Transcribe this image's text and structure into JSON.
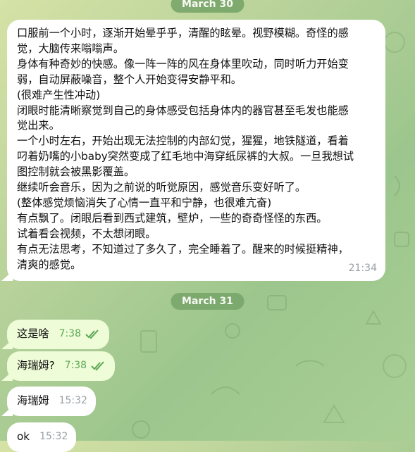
{
  "conversation": {
    "date_1": "March 30",
    "date_2": "March 31",
    "long_message": {
      "lines": [
        "口服前一个小时，逐渐开始晕乎乎，清醒的眩晕。视野模糊。奇怪的感",
        "觉，大脑传来嗡嗡声。",
        "身体有种奇妙的快感。像一阵一阵的风在身体里吹动，同时听力开始变",
        "弱，自动屏蔽噪音，整个人开始变得安静平和。",
        "(很难产生性冲动)",
        "闭眼时能清晰察觉到自己的身体感受包括身体内的器官甚至毛发也能感",
        "觉出来。",
        "一个小时左右，开始出现无法控制的内部幻觉，猩猩，地铁隧道，看着",
        "叼着奶嘴的小baby突然变成了红毛地中海穿纸尿裤的大叔。一旦我想试",
        "图控制就会被黑影覆盖。",
        "继续听会音乐，因为之前说的听觉原因，感觉音乐变好听了。",
        "(整体感觉烦恼消失了心情一直平和宁静，也很难亢奋)",
        "有点飘了。闭眼后看到西式建筑，壁炉，一些的奇奇怪怪的东西。",
        "试着看会视频，不太想闭眼。",
        "有点无法思考，不知道过了多久了，完全睡着了。醒来的时候挺精神，",
        "清爽的感觉。"
      ],
      "time": "21:34"
    },
    "short_messages": [
      {
        "text": "这是啥",
        "time": "7:38",
        "status": "read"
      },
      {
        "text": "海瑞姆?",
        "time": "7:38",
        "status": "read"
      },
      {
        "text": "海瑞姆",
        "time": "15:32",
        "status": ""
      },
      {
        "text": "ok",
        "time": "15:32",
        "status": ""
      }
    ]
  },
  "colors": {
    "outgoing_bubble": "#eefcd8",
    "incoming_bubble": "#ffffff",
    "date_pill": "#79a66a",
    "check_color": "#5ea755"
  }
}
